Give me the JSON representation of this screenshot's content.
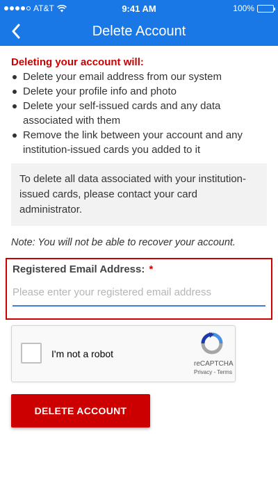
{
  "status_bar": {
    "carrier": "AT&T",
    "time": "9:41 AM",
    "battery": "100%"
  },
  "nav": {
    "title": "Delete Account",
    "back_icon": "chevron-left-icon"
  },
  "warning": {
    "heading": "Deleting your account will:",
    "items": [
      "Delete your email address from our system",
      "Delete your profile info and photo",
      "Delete your self-issued cards and any data associated with them",
      "Remove the link between your account and any institution-issued cards you added to it"
    ]
  },
  "info_box": {
    "text": "To delete all data associated with your institution-issued cards, please contact your card administrator."
  },
  "note": "Note: You will not be able to recover your account.",
  "email": {
    "label": "Registered Email Address:",
    "required_mark": "*",
    "value": "",
    "placeholder": "Please enter your registered email address"
  },
  "recaptcha": {
    "label": "I'm not a robot",
    "brand": "reCAPTCHA",
    "links": "Privacy - Terms"
  },
  "actions": {
    "delete_label": "DELETE ACCOUNT"
  },
  "colors": {
    "primary": "#1a78e6",
    "danger": "#cc0000",
    "input_underline": "#3b7ddd"
  }
}
